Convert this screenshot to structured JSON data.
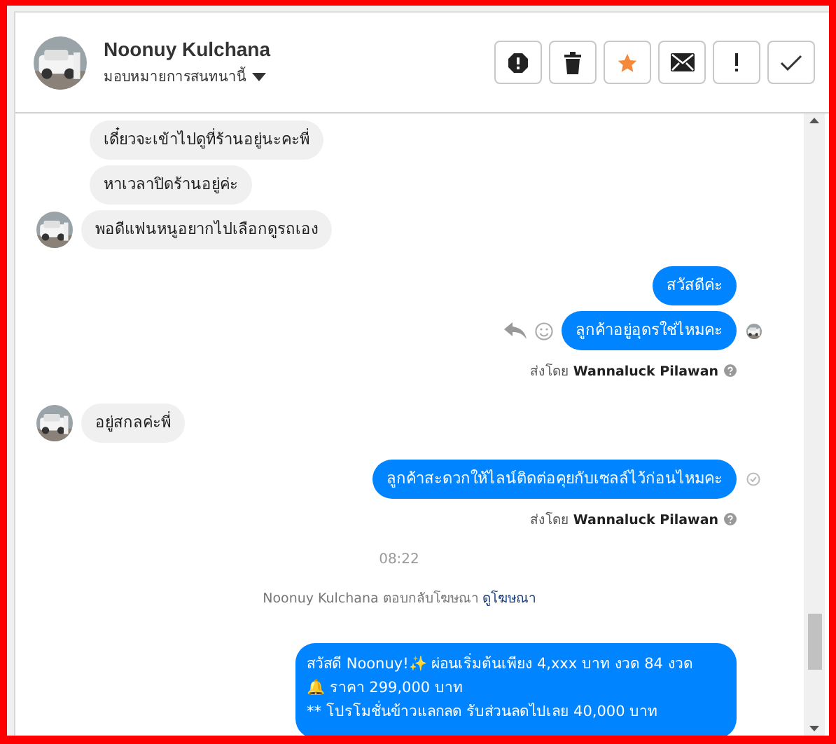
{
  "header": {
    "name": "Noonuy Kulchana",
    "assign_label": "มอบหมายการสนทนานี้",
    "actions": [
      {
        "kind": "spam"
      },
      {
        "kind": "delete"
      },
      {
        "kind": "star"
      },
      {
        "kind": "unread"
      },
      {
        "kind": "important"
      },
      {
        "kind": "done"
      }
    ]
  },
  "messages": [
    {
      "kind": "incoming",
      "text": "เดี๋ยวจะเข้าไปดูที่ร้านอยู่นะคะพี่",
      "avatar": false
    },
    {
      "kind": "incoming",
      "text": "หาเวลาปิดร้านอยู่ค่ะ",
      "avatar": false
    },
    {
      "kind": "incoming",
      "text": "พอดีแฟนหนูอยากไปเลือกดูรถเอง",
      "avatar": true
    },
    {
      "kind": "outgoing",
      "text": "สวัสดีค่ะ",
      "hover": false,
      "seen": false
    },
    {
      "kind": "outgoing",
      "text": "ลูกค้าอยู่อุดรใช่ไหมคะ",
      "hover": true,
      "seen": true
    },
    {
      "kind": "sent_by",
      "prefix": "ส่งโดย",
      "name": "Wannaluck Pilawan"
    },
    {
      "kind": "incoming",
      "text": "อยู่สกลค่ะพี่",
      "avatar": true
    },
    {
      "kind": "outgoing",
      "text": "ลูกค้าสะดวกให้ไลน์ติดต่อคุยกับเซลล์ไว้ก่อนไหมคะ",
      "hover": false,
      "seen": false
    },
    {
      "kind": "sent_by",
      "prefix": "ส่งโดย",
      "name": "Wannaluck Pilawan"
    },
    {
      "kind": "time",
      "text": "08:22"
    },
    {
      "kind": "notice",
      "text": "Noonuy Kulchana ตอบกลับโฆษณา",
      "link": "ดูโฆษณา"
    },
    {
      "kind": "ad_reply",
      "lines": [
        "สวัสดี Noonuy!✨  ผ่อนเริ่มต้นเพียง 4,xxx บาท งวด 84 งวด",
        "🔔 ราคา 299,000 บาท",
        "** โปรโมชั่นข้าวแลกลด รับส่วนลดไปเลย 40,000 บาท"
      ]
    }
  ]
}
